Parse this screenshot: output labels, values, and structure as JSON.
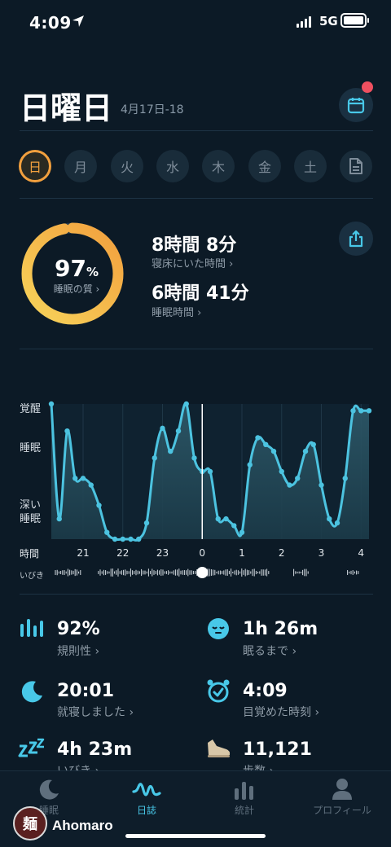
{
  "status_bar": {
    "time": "4:09",
    "network": "5G"
  },
  "header": {
    "day": "日曜日",
    "date_range": "4月17日-18"
  },
  "week_days": [
    "日",
    "月",
    "火",
    "水",
    "木",
    "金",
    "土"
  ],
  "selected_day": "日",
  "summary": {
    "score": "97",
    "score_unit": "%",
    "score_label": "睡眠の質 ›",
    "score_fraction": 0.97,
    "time_in_bed": "8時間 8分",
    "time_in_bed_label": "寝床にいた時間 ›",
    "sleep_time": "6時間 41分",
    "sleep_time_label": "睡眠時間 ›"
  },
  "chart_data": {
    "type": "area",
    "y_categories": [
      "覚醒",
      "睡眠",
      "深い睡眠"
    ],
    "x_label": "時間",
    "x_ticks": [
      "21",
      "22",
      "23",
      "0",
      "1",
      "2",
      "3",
      "4"
    ],
    "snore_label": "いびき",
    "x": [
      20.2,
      20.4,
      20.6,
      20.8,
      21.0,
      21.2,
      21.4,
      21.6,
      21.8,
      22.0,
      22.2,
      22.4,
      22.6,
      22.8,
      23.0,
      23.2,
      23.4,
      23.6,
      23.8,
      24.0,
      24.2,
      24.4,
      24.6,
      24.8,
      25.0,
      25.2,
      25.4,
      25.6,
      25.8,
      26.0,
      26.2,
      26.4,
      26.6,
      26.8,
      27.0,
      27.2,
      27.4,
      27.6,
      27.8,
      28.0,
      28.2
    ],
    "depth": [
      0.0,
      0.85,
      0.2,
      0.55,
      0.55,
      0.6,
      0.75,
      0.95,
      1.0,
      1.0,
      1.0,
      1.0,
      0.88,
      0.4,
      0.18,
      0.35,
      0.2,
      0.0,
      0.4,
      0.5,
      0.5,
      0.85,
      0.85,
      0.9,
      0.95,
      0.45,
      0.25,
      0.3,
      0.35,
      0.5,
      0.6,
      0.55,
      0.35,
      0.3,
      0.6,
      0.85,
      0.88,
      0.55,
      0.05,
      0.05,
      0.05
    ],
    "current_x": 24.0,
    "accent": "#4cc3e0"
  },
  "metrics": [
    {
      "value": "92%",
      "label": "規則性 ›",
      "icon": "regularity-bars-icon"
    },
    {
      "value": "1h 26m",
      "label": "眠るまで ›",
      "icon": "sleepy-face-icon"
    },
    {
      "value": "20:01",
      "label": "就寝しました ›",
      "icon": "moon-icon"
    },
    {
      "value": "4:09",
      "label": "目覚めた時刻 ›",
      "icon": "alarm-clock-icon"
    },
    {
      "value": "4h 23m",
      "label": "いびき ›",
      "icon": "zzz-icon"
    },
    {
      "value": "11,121",
      "label": "歩数 ›",
      "icon": "shoe-icon"
    }
  ],
  "tabs": [
    {
      "label": "睡眠",
      "icon": "moon-icon",
      "active": false
    },
    {
      "label": "日誌",
      "icon": "wave-icon",
      "active": true
    },
    {
      "label": "統計",
      "icon": "bar-chart-icon",
      "active": false
    },
    {
      "label": "プロフィール",
      "icon": "person-icon",
      "active": false
    }
  ],
  "watermark": {
    "avatar_char": "麺",
    "name": "Ahomaro"
  },
  "colors": {
    "background": "#0c1a26",
    "accent": "#48c8e8",
    "score_ring": "#f2a03e"
  }
}
